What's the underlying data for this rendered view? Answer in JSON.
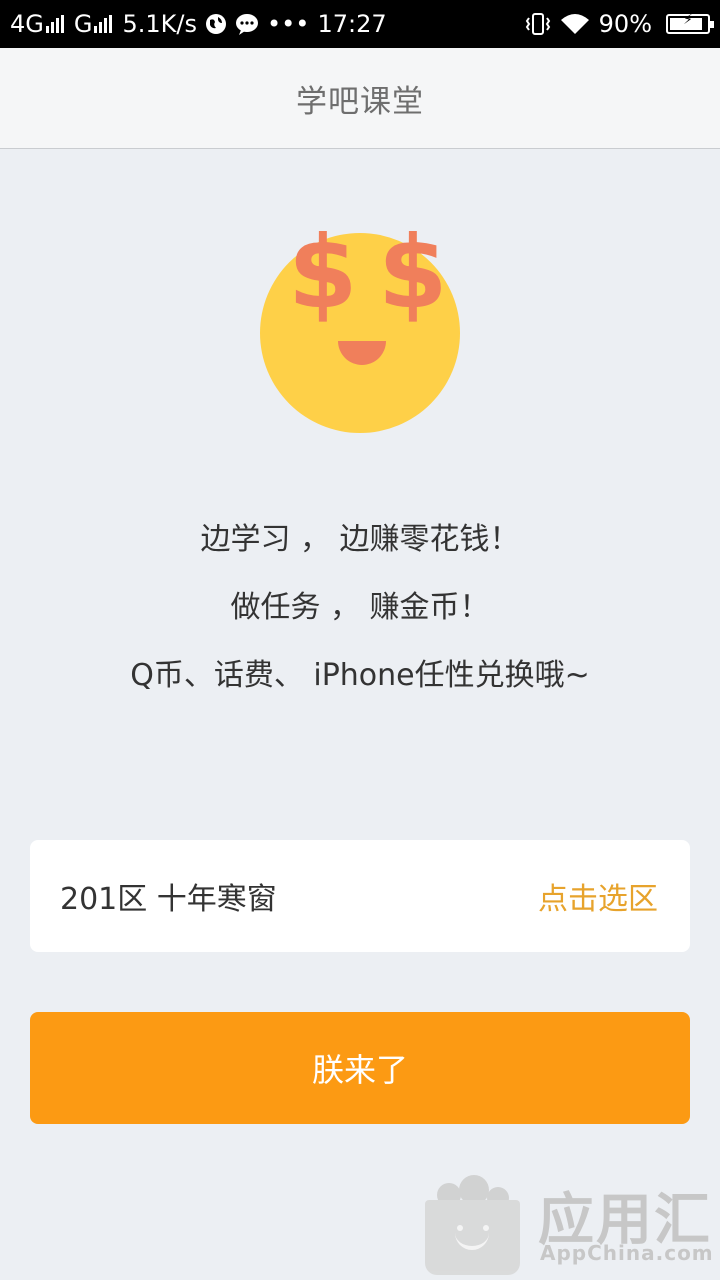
{
  "status_bar": {
    "network_1": "4G",
    "network_2": "G",
    "speed": "5.1K/s",
    "dots": "•••",
    "time": "17:27",
    "battery": "90%",
    "battery_level": 0.9
  },
  "header": {
    "title": "学吧课堂"
  },
  "intro": {
    "lines": [
      "边学习 ， 边赚零花钱！",
      "做任务 ， 赚金币！",
      "Q币、话费、 iPhone任性兑换哦~"
    ]
  },
  "emoji": {
    "symbol": "$"
  },
  "server": {
    "current": "201区 十年寒窗",
    "action": "点击选区"
  },
  "cta": {
    "label": "朕来了"
  },
  "watermark": {
    "title": "应用汇",
    "subtitle": "AppChina.com"
  },
  "colors": {
    "accent": "#fc9a13",
    "link": "#e7a32c",
    "emoji_face": "#fed048",
    "emoji_features": "#f07f5b",
    "background": "#eceff3"
  }
}
